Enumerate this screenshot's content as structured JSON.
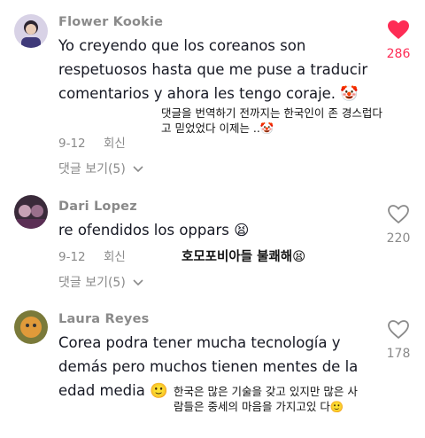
{
  "comments": [
    {
      "username": "Flower Kookie",
      "text": "Yo creyendo que los coreanos son respetuosos hasta que me puse a traducir comentarios y ahora les tengo coraje.",
      "emoji": "🤡",
      "date": "9-12",
      "reply_label": "회신",
      "replies_label": "댓글 보기(5)",
      "likes": "286",
      "liked": true,
      "annotation": "댓글을 번역하기 전까지는 한국인이 존 경스럽다고 믿었었다 이제는 ..🤡"
    },
    {
      "username": "Dari Lopez",
      "text": "re ofendidos los oppars",
      "emoji": "😫",
      "date": "9-12",
      "reply_label": "회신",
      "replies_label": "댓글 보기(5)",
      "likes": "220",
      "liked": false,
      "annotation": "호모포비아들 불쾌해😫"
    },
    {
      "username": "Laura Reyes",
      "text": "Corea podra tener mucha tecnología y demás pero muchos tienen mentes de la edad media",
      "emoji": "🙂",
      "likes": "178",
      "liked": false,
      "annotation": "한국은 많은 기술을 갖고 있지만 많은 사람들은 중세의 마음을 가지고있 다🙂"
    }
  ],
  "colors": {
    "like_active": "#fe2c55",
    "muted": "#8a8a8a",
    "text": "#161823"
  }
}
